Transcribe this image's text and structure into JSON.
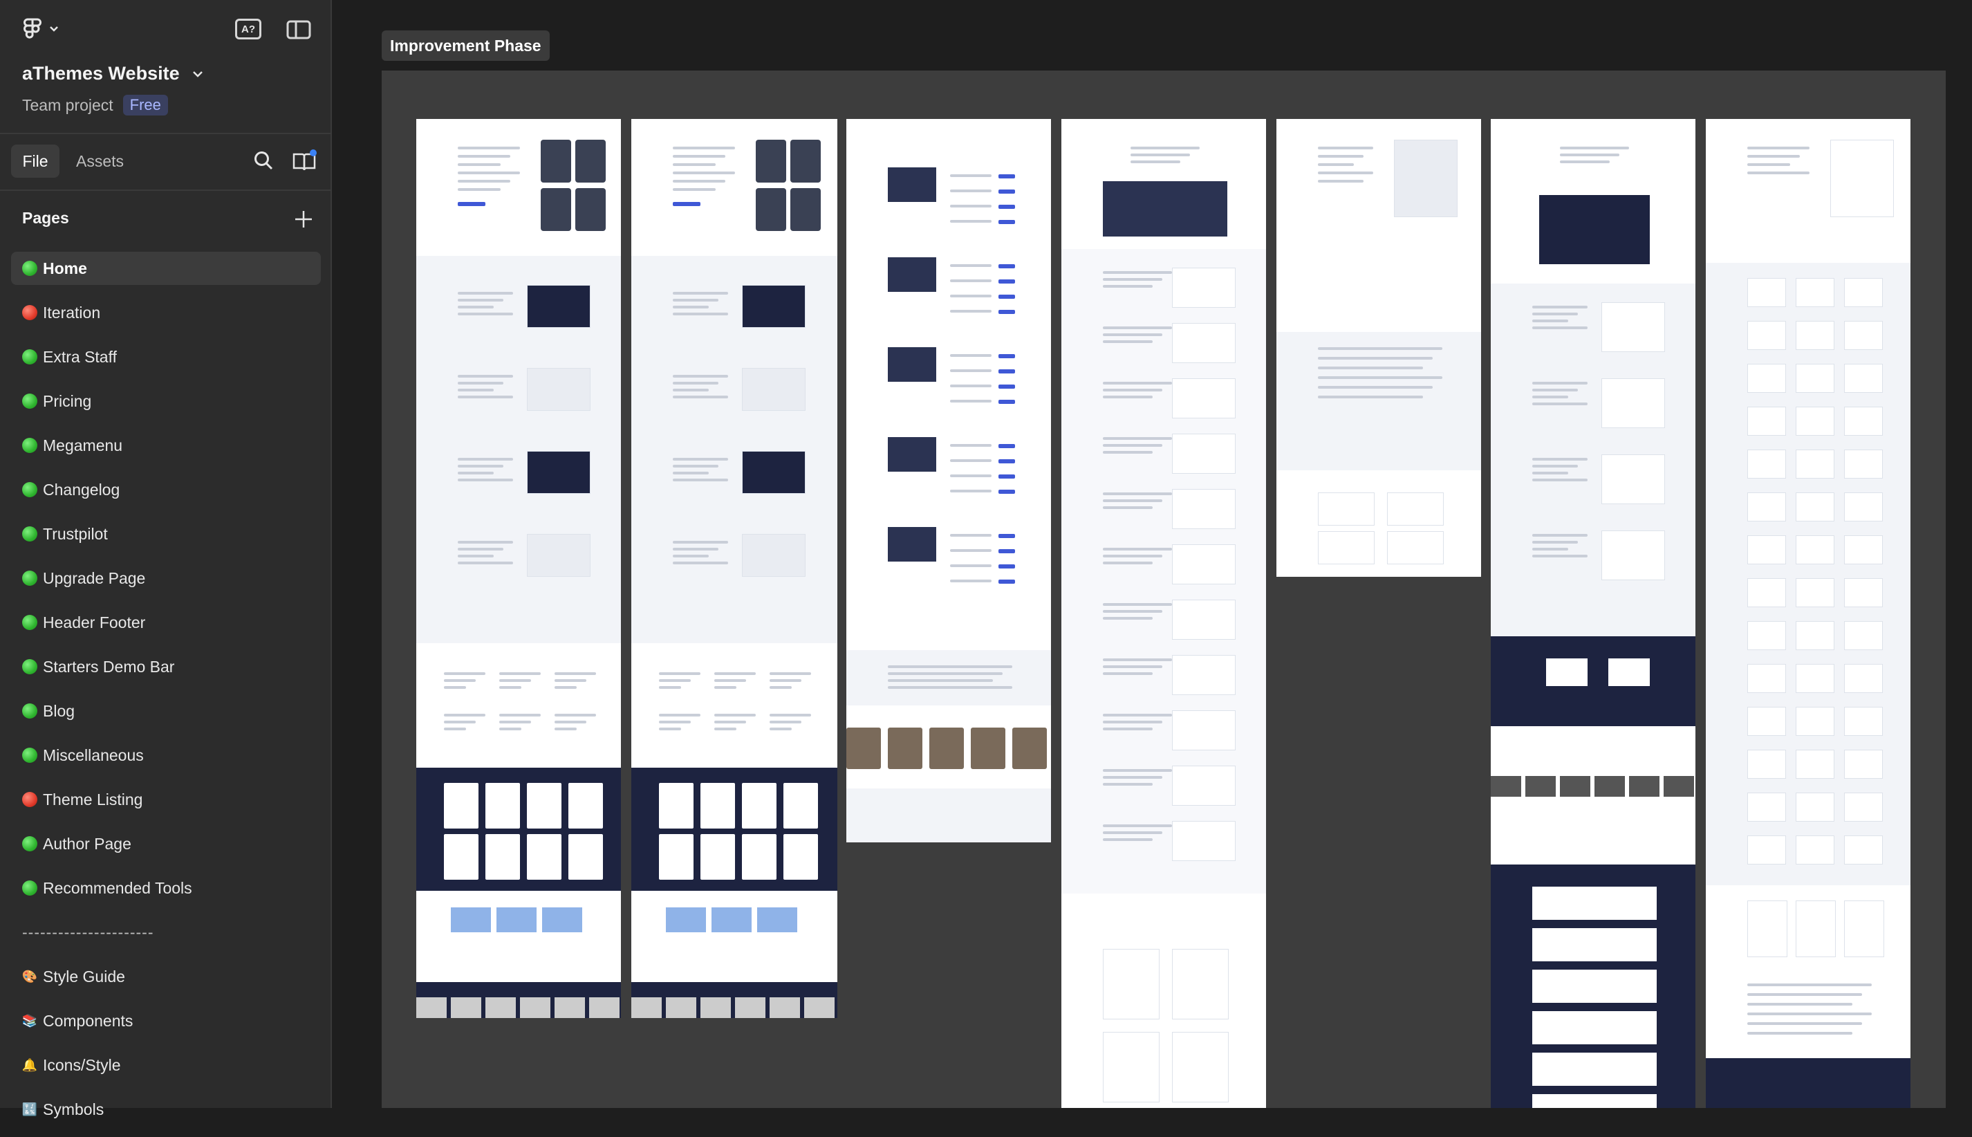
{
  "app": {
    "project_name": "aThemes Website",
    "team_label": "Team project",
    "plan_badge": "Free",
    "ai_button": "A?"
  },
  "tabs": {
    "file": "File",
    "assets": "Assets"
  },
  "pages": {
    "header": "Pages",
    "items": [
      {
        "label": "Home",
        "status": "green",
        "active": true
      },
      {
        "label": "Iteration",
        "status": "red"
      },
      {
        "label": "Extra Staff",
        "status": "green"
      },
      {
        "label": "Pricing",
        "status": "green"
      },
      {
        "label": "Megamenu",
        "status": "green"
      },
      {
        "label": "Changelog",
        "status": "green"
      },
      {
        "label": "Trustpilot",
        "status": "green"
      },
      {
        "label": "Upgrade Page",
        "status": "green"
      },
      {
        "label": "Header Footer",
        "status": "green"
      },
      {
        "label": "Starters Demo Bar",
        "status": "green"
      },
      {
        "label": "Blog",
        "status": "green"
      },
      {
        "label": "Miscellaneous",
        "status": "green"
      },
      {
        "label": "Theme Listing",
        "status": "red"
      },
      {
        "label": "Author Page",
        "status": "green"
      },
      {
        "label": "Recommended Tools",
        "status": "green"
      },
      {
        "label": "----------------------",
        "status": "separator"
      },
      {
        "label": "Style Guide",
        "icon": "palette-icon",
        "glyph": "🎨"
      },
      {
        "label": "Components",
        "icon": "books-icon",
        "glyph": "📚"
      },
      {
        "label": "Icons/Style",
        "icon": "bell-icon",
        "glyph": "🔔"
      },
      {
        "label": "Symbols",
        "icon": "symbols-icon",
        "glyph": "🔣"
      }
    ]
  },
  "canvas": {
    "section_label": "Improvement Phase"
  },
  "colors": {
    "sidebar_bg": "#2c2c2c",
    "canvas_bg": "#1e1e1e",
    "section_bg": "#3d3d3d",
    "badge_bg": "#3a4060",
    "badge_text": "#a9b7ff",
    "status_green": "#2fb52f",
    "status_red": "#e23b2b"
  }
}
